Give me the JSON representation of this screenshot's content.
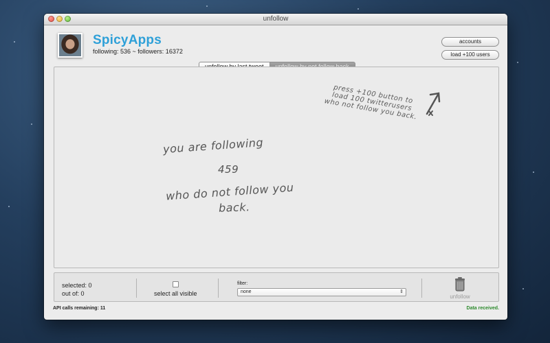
{
  "window": {
    "title": "unfollow"
  },
  "profile": {
    "name": "SpicyApps",
    "stats": "following: 536  ~  followers: 16372"
  },
  "header_buttons": {
    "accounts": "accounts",
    "load_users": "load +100 users"
  },
  "tabs": [
    {
      "label": "unfollow by last tweet",
      "selected": false
    },
    {
      "label": "unfollow by not follow back",
      "selected": true
    }
  ],
  "main": {
    "hint_lines": [
      "press +100 button to",
      "load 100 twitterusers",
      "who not follow you back."
    ],
    "message_line1": "you are following",
    "count": "459",
    "message_line2": "who do not follow you",
    "message_line3": "back."
  },
  "bottom_bar": {
    "selected_label": "selected: 0",
    "outof_label": "out of: 0",
    "select_all_label": "select all visible",
    "filter_label": "filter:",
    "filter_value": "none",
    "unfollow_label": "unfollow"
  },
  "footer": {
    "api_calls": "API calls remaining: 11",
    "status": "Data received."
  },
  "colors": {
    "username": "#2ea0d8",
    "status_ok": "#2d8a2d"
  }
}
